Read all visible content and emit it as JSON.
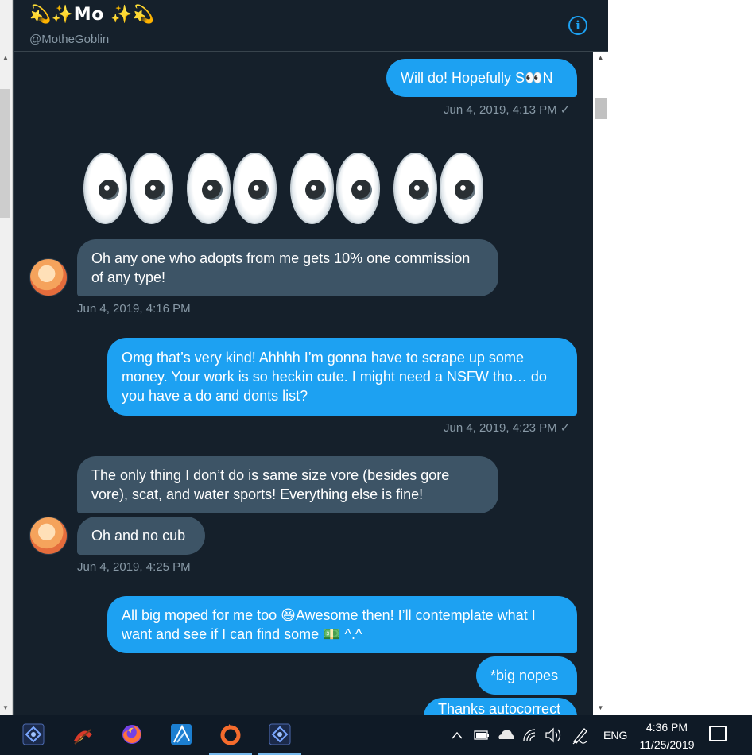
{
  "header": {
    "name_emoji_left": "💫✨",
    "name": "Mo",
    "name_emoji_right": "✨💫",
    "handle": "@MotheGoblin",
    "info_icon": "info-icon"
  },
  "messages": [
    {
      "from": "me",
      "text": "Will do! Hopefully S👀N"
    },
    {
      "from": "me",
      "stamp": "Jun 4, 2019, 4:13 PM"
    },
    {
      "from": "them",
      "text": "👀 👀 👀 👀"
    },
    {
      "from": "them",
      "text": "Oh any one who adopts from me gets 10% one commission of any type!"
    },
    {
      "from": "them",
      "stamp": "Jun 4, 2019, 4:16 PM"
    },
    {
      "from": "me",
      "text": "Omg that’s very kind! Ahhhh I’m gonna have to scrape up some money. Your work is so heckin cute. I might need a NSFW tho… do you have a do and donts list?"
    },
    {
      "from": "me",
      "stamp": "Jun 4, 2019, 4:23 PM"
    },
    {
      "from": "them",
      "text": "The only thing I don’t do is same size vore (besides gore vore), scat, and water sports! Everything else is fine!"
    },
    {
      "from": "them",
      "text": "Oh and no cub"
    },
    {
      "from": "them",
      "stamp": "Jun 4, 2019, 4:25 PM"
    },
    {
      "from": "me",
      "text": "All big moped for me too 😆Awesome then! I’ll contemplate what I want and see if I can find some 💵 ^.^"
    },
    {
      "from": "me",
      "text": "*big nopes"
    },
    {
      "from": "me",
      "text": "Thanks autocorrect"
    }
  ],
  "check_mark": "✓",
  "taskbar": {
    "apps": [
      "affinity-photo-icon",
      "paint-app-icon",
      "firefox-icon",
      "affinity-designer-icon",
      "origin-icon",
      "affinity-photo-icon"
    ],
    "tray_chevron": "^",
    "language": "ENG",
    "time": "4:36 PM",
    "date": "11/25/2019"
  }
}
